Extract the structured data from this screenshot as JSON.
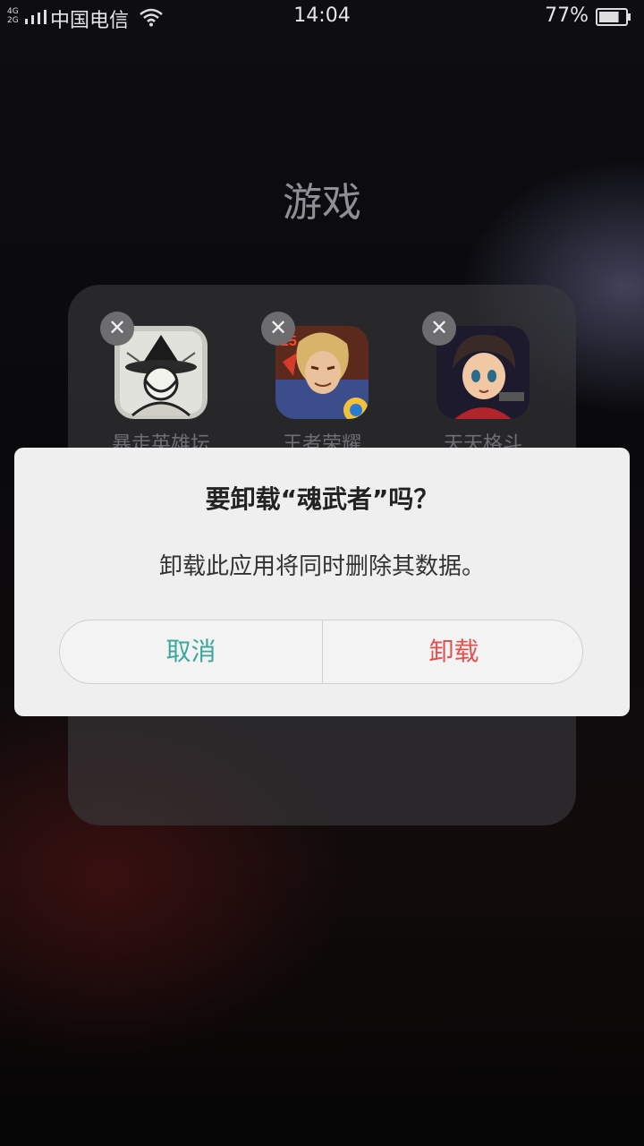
{
  "status_bar": {
    "network_top": "4G",
    "network_bottom": "2G",
    "carrier": "中国电信",
    "time": "14:04",
    "battery_percent": "77%",
    "battery_level": 0.77
  },
  "folder": {
    "title": "游戏",
    "apps": [
      {
        "label": "暴走英雄坛",
        "icon": "masked-hero-icon",
        "removable": true
      },
      {
        "label": "王者荣耀",
        "icon": "king-glory-icon",
        "removable": true
      },
      {
        "label": "天天格斗",
        "icon": "fighter-boy-icon",
        "removable": true
      },
      {
        "label": "",
        "icon": "app-icon",
        "removable": true
      },
      {
        "label": "",
        "icon": "app-icon",
        "removable": false
      }
    ]
  },
  "dialog": {
    "title": "要卸载“魂武者”吗？",
    "message": "卸载此应用将同时删除其数据。",
    "cancel_label": "取消",
    "confirm_label": "卸载"
  },
  "colors": {
    "cancel": "#3aa89a",
    "confirm": "#e0514f",
    "dialog_bg": "#efefef"
  }
}
